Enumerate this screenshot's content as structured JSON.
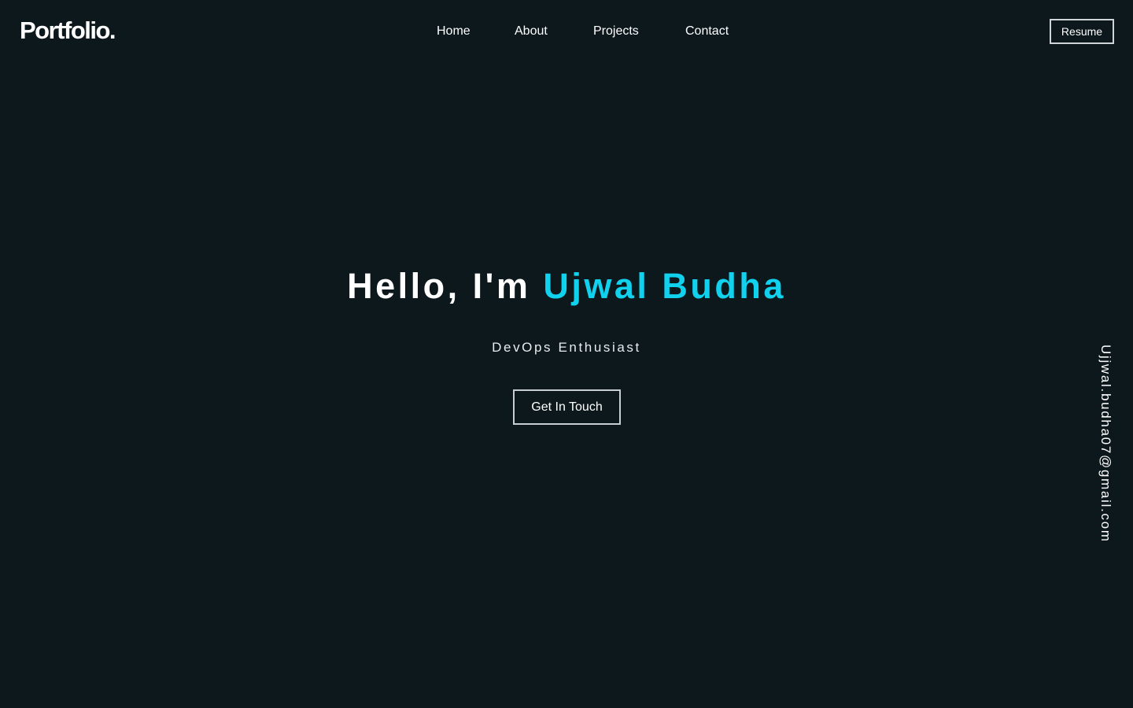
{
  "header": {
    "logo": "Portfolio.",
    "nav": {
      "home": "Home",
      "about": "About",
      "projects": "Projects",
      "contact": "Contact"
    },
    "resume_label": "Resume"
  },
  "hero": {
    "greeting": "Hello, I'm ",
    "name": "Ujwal Budha",
    "subtitle": "DevOps Enthusiast",
    "cta_label": "Get In Touch"
  },
  "sidebar": {
    "email": "Ujjwal.budha07@gmail.com"
  },
  "colors": {
    "background": "#0d181d",
    "accent": "#11d2ee",
    "text": "#ffffff"
  }
}
